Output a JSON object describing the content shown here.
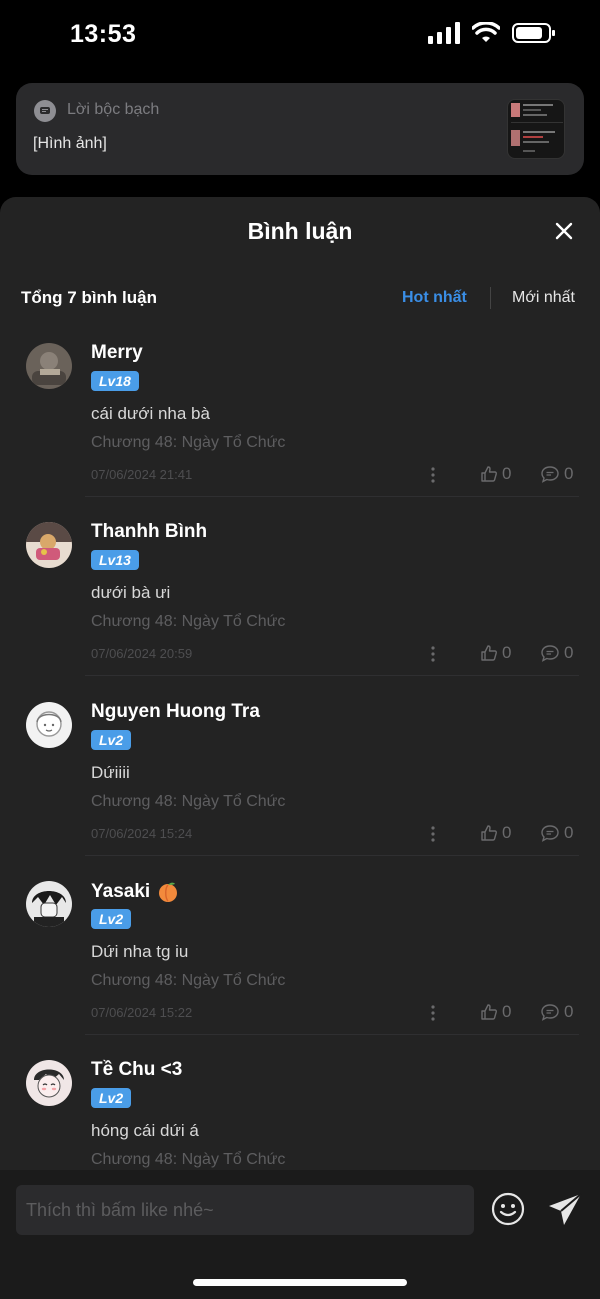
{
  "status_bar": {
    "time": "13:53"
  },
  "notification": {
    "app_name": "Lời bộc bạch",
    "body": "[Hình ảnh]"
  },
  "sheet": {
    "title": "Bình luận",
    "summary": "Tổng 7 bình luận",
    "sort_hot": "Hot nhất",
    "sort_new": "Mới nhất"
  },
  "comments": [
    {
      "username": "Merry",
      "level": "Lv18",
      "content": "cái dưới nha bà",
      "chapter": "Chương 48: Ngày Tổ Chức",
      "date": "07/06/2024 21:41",
      "likes": "0",
      "replies": "0"
    },
    {
      "username": "Thanhh Bình",
      "level": "Lv13",
      "content": "dưới bà ưi",
      "chapter": "Chương 48: Ngày Tổ Chức",
      "date": "07/06/2024 20:59",
      "likes": "0",
      "replies": "0"
    },
    {
      "username": "Nguyen Huong Tra",
      "level": "Lv2",
      "content": "Dứiiii",
      "chapter": "Chương 48: Ngày Tổ Chức",
      "date": "07/06/2024 15:24",
      "likes": "0",
      "replies": "0"
    },
    {
      "username": "Yasaki",
      "level": "Lv2",
      "content": "Dứi nha tg iu",
      "chapter": "Chương 48: Ngày Tổ Chức",
      "date": "07/06/2024 15:22",
      "likes": "0",
      "replies": "0"
    },
    {
      "username": "Tề Chu <3",
      "level": "Lv2",
      "content": "hóng cái dứi á",
      "chapter": "Chương 48: Ngày Tổ Chức",
      "date": "",
      "likes": "",
      "replies": ""
    }
  ],
  "input": {
    "placeholder": "Thích thì bấm like nhé~"
  },
  "colors": {
    "accent": "#3a8ee6",
    "level_badge": "#4a9de8",
    "sheet_bg": "#232323"
  }
}
